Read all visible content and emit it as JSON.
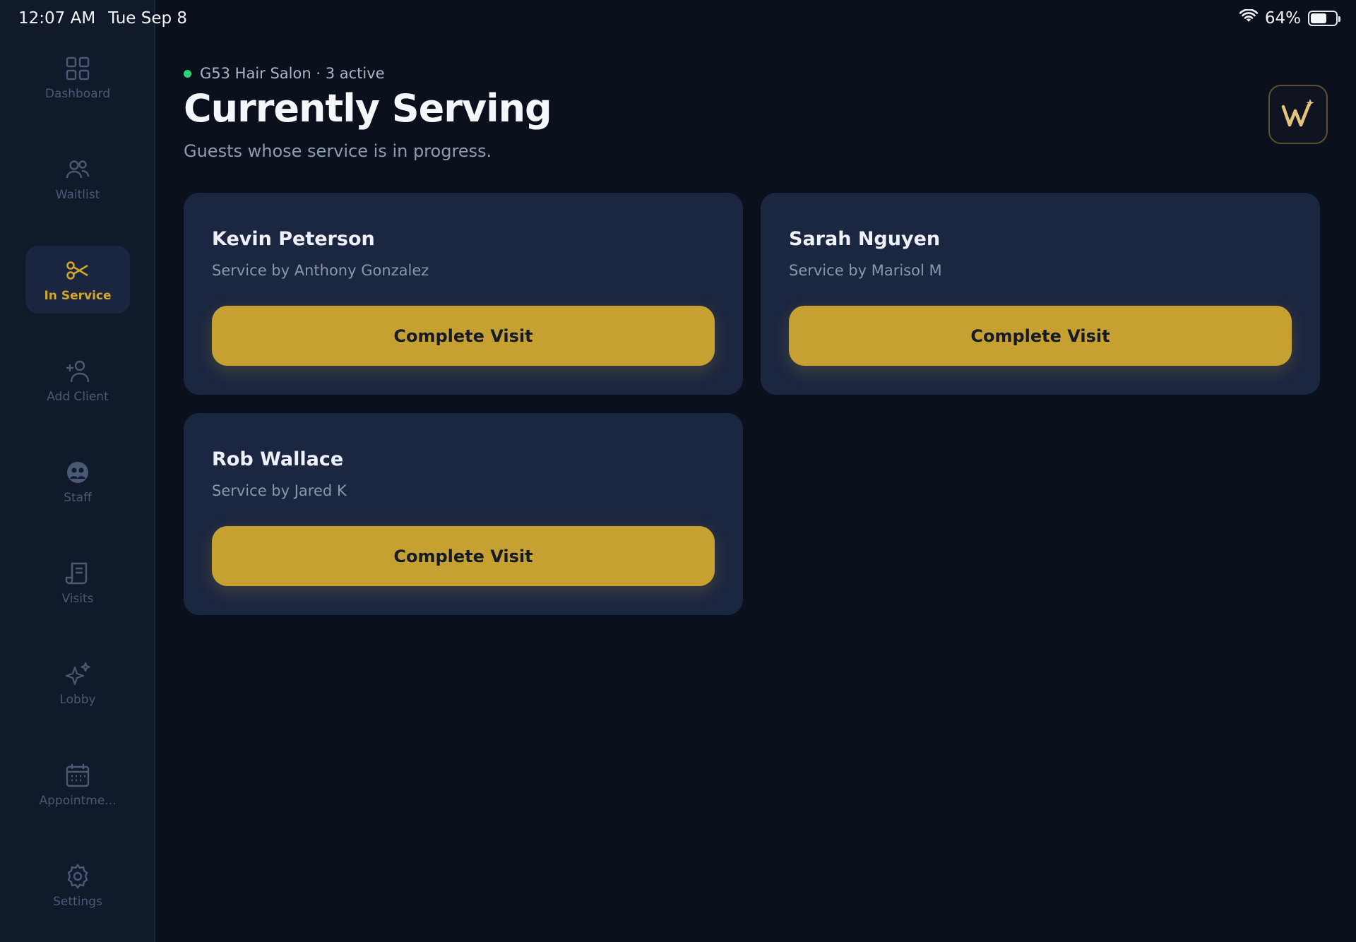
{
  "status_bar": {
    "time": "12:07 AM",
    "date": "Tue Sep 8",
    "battery": "64%",
    "battery_level": 0.64
  },
  "sidebar": {
    "items": [
      {
        "label": "Dashboard",
        "icon": "grid-icon"
      },
      {
        "label": "Waitlist",
        "icon": "people-icon"
      },
      {
        "label": "In Service",
        "icon": "scissors-icon",
        "active": true
      },
      {
        "label": "Add Client",
        "icon": "add-person-icon"
      },
      {
        "label": "Staff",
        "icon": "staff-icon"
      },
      {
        "label": "Visits",
        "icon": "receipt-icon"
      },
      {
        "label": "Lobby",
        "icon": "sparkles-icon"
      },
      {
        "label": "Appointme...",
        "icon": "calendar-icon"
      },
      {
        "label": "Settings",
        "icon": "gear-icon"
      }
    ]
  },
  "header": {
    "salon_status": "G53 Hair Salon · 3 active",
    "title": "Currently Serving",
    "description": "Guests whose service is in progress."
  },
  "cards": [
    {
      "name": "Kevin Peterson",
      "service": "Service by Anthony Gonzalez",
      "button": "Complete Visit"
    },
    {
      "name": "Sarah Nguyen",
      "service": "Service by Marisol M",
      "button": "Complete Visit"
    },
    {
      "name": "Rob Wallace",
      "service": "Service by Jared K",
      "button": "Complete Visit"
    }
  ],
  "colors": {
    "accent": "#c6a030",
    "active_nav": "#d4a52b",
    "status_dot": "#2fd07a",
    "background": "#0a101c",
    "card": "#1b2640"
  }
}
